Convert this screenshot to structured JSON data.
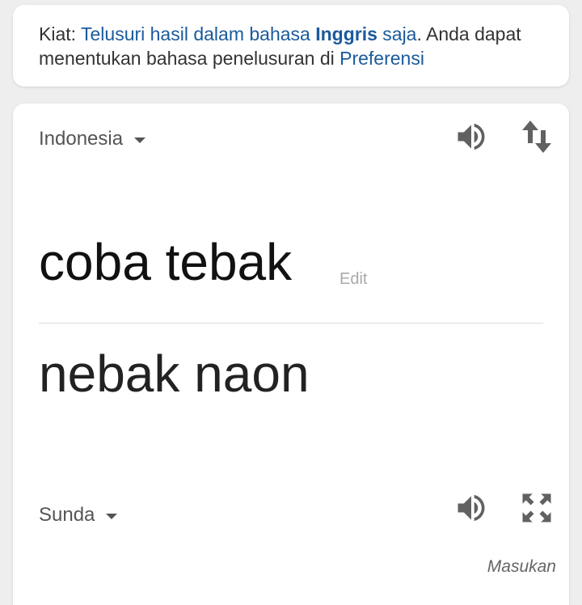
{
  "tip": {
    "prefix": "Kiat: ",
    "link_before": "Telusuri hasil dalam bahasa ",
    "link_bold": "Inggris",
    "link_after": " saja",
    "middle": ". Anda dapat menentukan bahasa penelusuran di ",
    "preferences_link": "Preferensi"
  },
  "translator": {
    "source_language": "Indonesia",
    "source_text": "coba tebak",
    "edit_label": "Edit",
    "translated_text": "nebak naon",
    "target_language": "Sunda",
    "feedback_label": "Masukan"
  },
  "icons": {
    "speaker": "speaker-icon",
    "swap": "swap-languages-icon",
    "expand": "fullscreen-expand-icon",
    "dropdown": "caret-down-icon"
  },
  "colors": {
    "link": "#1a5a9c",
    "text": "#333333",
    "icon": "#616161",
    "background": "#eeeeee"
  }
}
